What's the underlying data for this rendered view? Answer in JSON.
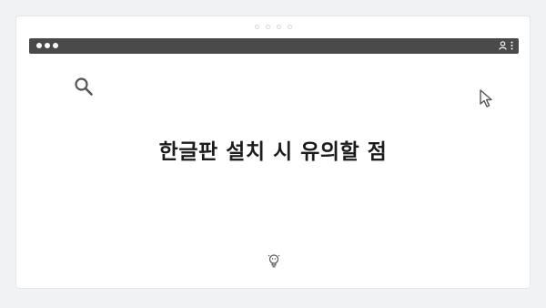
{
  "page": {
    "headline": "한글판 설치 시 유의할 점"
  },
  "icons": {
    "search": "search-icon",
    "cursor": "cursor-arrow-icon",
    "bulb": "lightbulb-icon",
    "user": "user-icon",
    "menu": "kebab-menu-icon"
  },
  "colors": {
    "background": "#f1f2f4",
    "card": "#ffffff",
    "browser_bar": "#4a4a4a",
    "text": "#1c1c1c",
    "icon": "#555555"
  }
}
